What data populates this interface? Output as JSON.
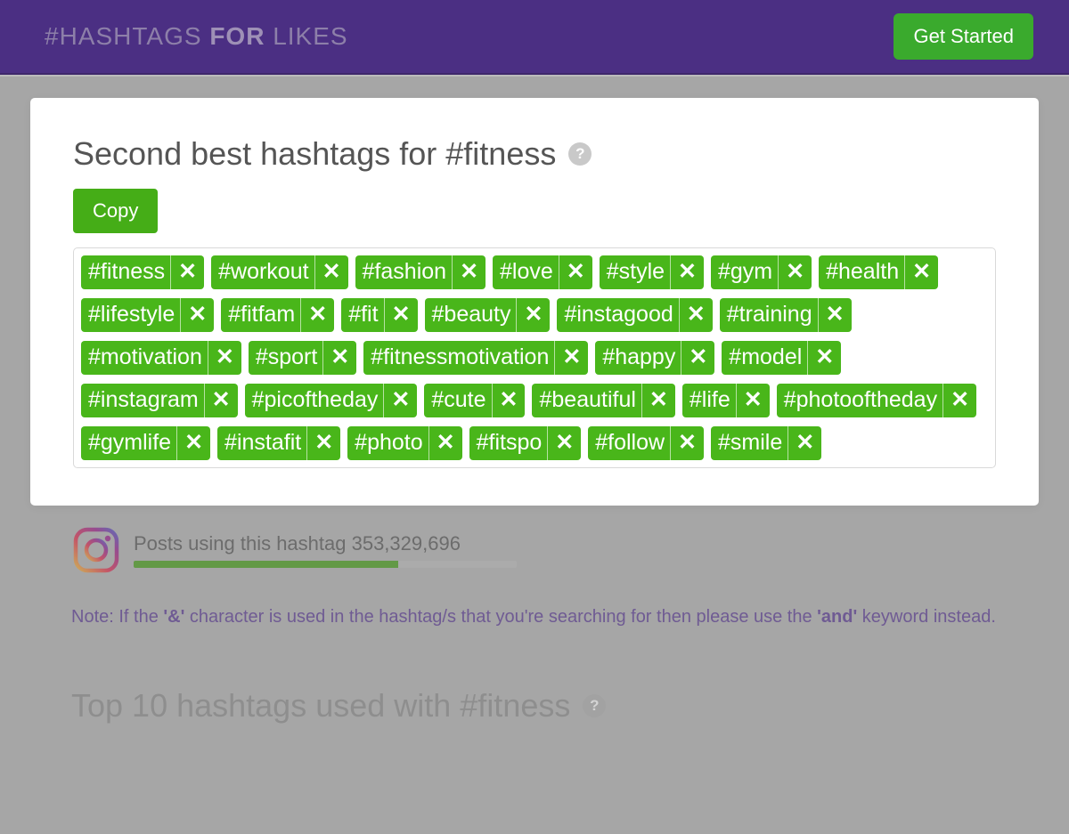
{
  "header": {
    "logo_prefix": "#HASHTAGS ",
    "logo_bold": "FOR",
    "logo_suffix": " LIKES",
    "get_started": "Get Started"
  },
  "card": {
    "title": "Second best hashtags for #fitness",
    "copy_label": "Copy",
    "tags": [
      "#fitness",
      "#workout",
      "#fashion",
      "#love",
      "#style",
      "#gym",
      "#health",
      "#lifestyle",
      "#fitfam",
      "#fit",
      "#beauty",
      "#instagood",
      "#training",
      "#motivation",
      "#sport",
      "#fitnessmotivation",
      "#happy",
      "#model",
      "#instagram",
      "#picoftheday",
      "#cute",
      "#beautiful",
      "#life",
      "#photooftheday",
      "#gymlife",
      "#instafit",
      "#photo",
      "#fitspo",
      "#follow",
      "#smile"
    ]
  },
  "posts": {
    "label": "Posts using this hashtag ",
    "count": "353,329,696",
    "progress_pct": 69
  },
  "note": {
    "p1": "Note: If the ",
    "b1": "'&'",
    "p2": " character is used in the hashtag/s that you're searching for then please use the ",
    "b2": "'and'",
    "p3": " keyword instead."
  },
  "section2": {
    "title": "Top 10 hashtags used with #fitness"
  },
  "icons": {
    "help": "?",
    "remove": "✕"
  }
}
